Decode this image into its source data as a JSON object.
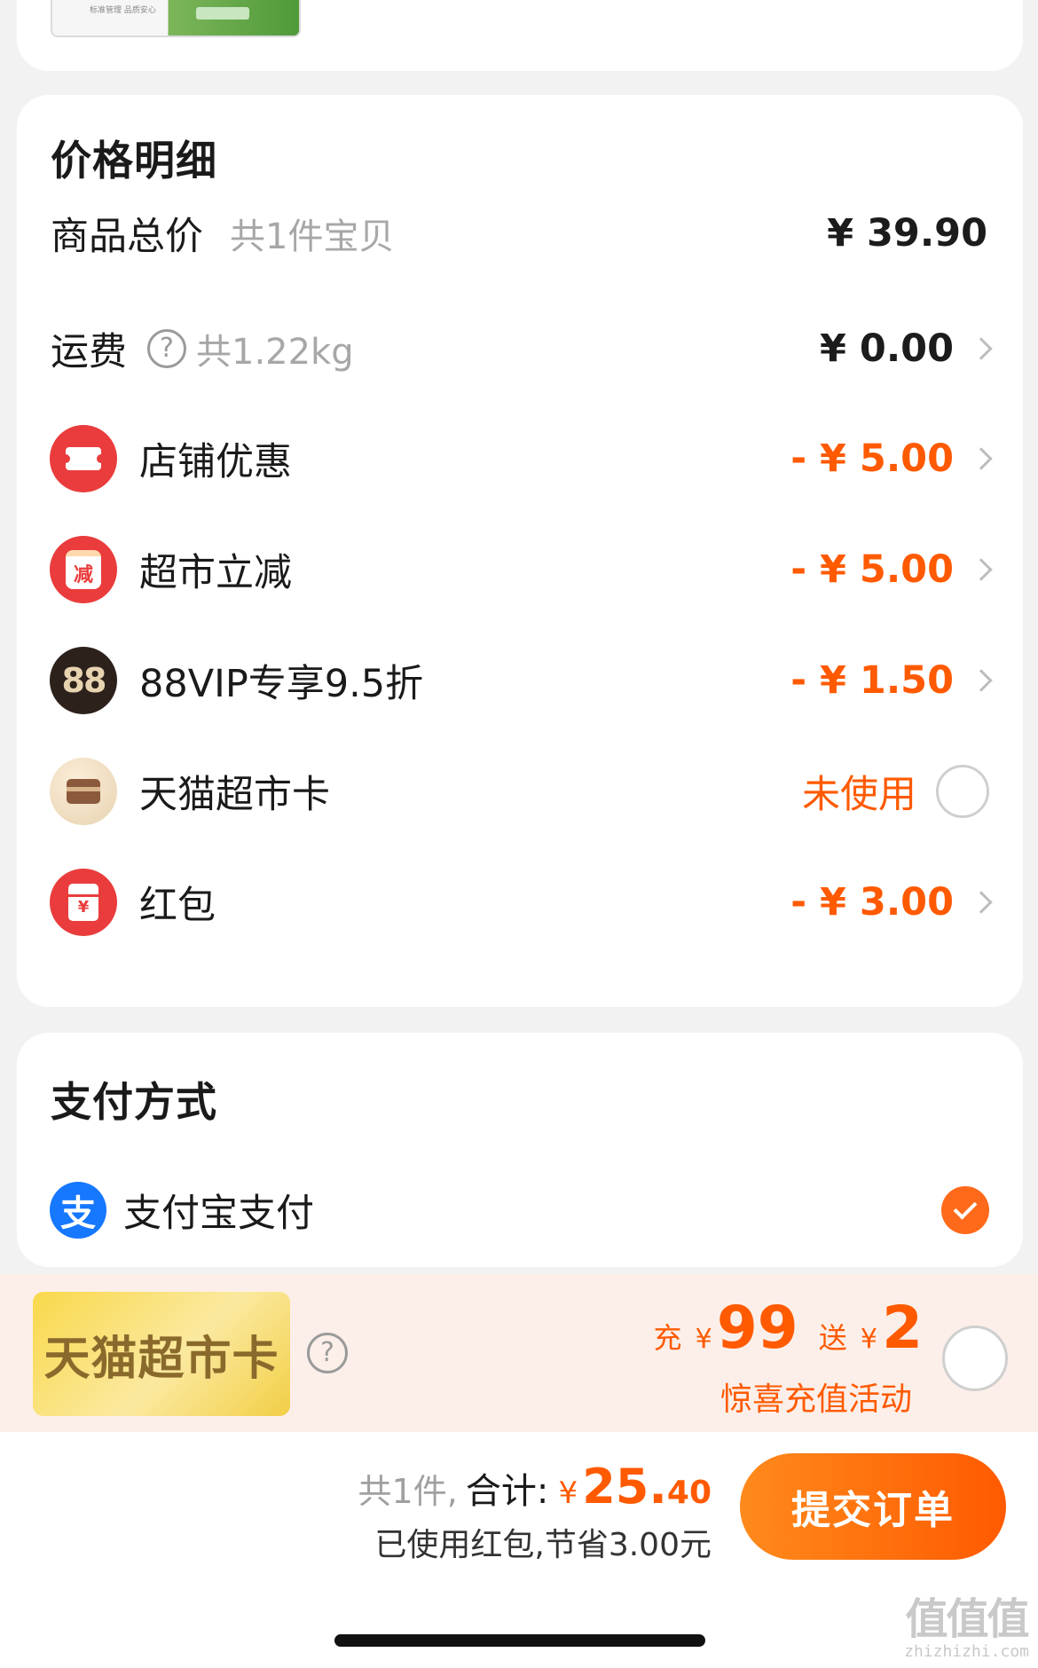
{
  "product": {
    "thumb_caption": "标准管理 品质安心"
  },
  "price_detail": {
    "title": "价格明细",
    "subtotal": {
      "label": "商品总价",
      "note": "共1件宝贝",
      "amount": "¥ 39.90"
    },
    "shipping": {
      "label": "运费",
      "note": "共1.22kg",
      "amount": "¥ 0.00"
    },
    "discounts": [
      {
        "label": "店铺优惠",
        "amount": "- ¥ 5.00",
        "icon": "ticket-icon"
      },
      {
        "label": "超市立减",
        "amount": "- ¥ 5.00",
        "icon": "jian-icon",
        "glyph": "减"
      },
      {
        "label": "88VIP专享9.5折",
        "amount": "- ¥ 1.50",
        "icon": "88vip-icon",
        "glyph": "88"
      },
      {
        "label": "天猫超市卡",
        "status": "未使用",
        "icon": "card-icon"
      },
      {
        "label": "红包",
        "amount": "- ¥ 3.00",
        "icon": "red-envelope-icon",
        "glyph": "¥"
      }
    ]
  },
  "payment": {
    "title": "支付方式",
    "method": {
      "label": "支付宝支付",
      "glyph": "支",
      "selected": true
    }
  },
  "promo": {
    "card_label": "天猫超市卡",
    "charge_prefix": "充",
    "charge_yen": "¥",
    "charge_amount": "99",
    "gift_prefix": "送",
    "gift_yen": "¥",
    "gift_amount": "2",
    "subtitle": "惊喜充值活动",
    "selected": false
  },
  "checkout": {
    "count_text": "共1件,",
    "total_label": "合计:",
    "currency": "¥",
    "total_int": "25.",
    "total_dec": "40",
    "saved_text": "已使用红包,节省3.00元",
    "submit_label": "提交订单"
  },
  "watermark": {
    "logo": "值值值",
    "url": "zhizhizhi.com"
  },
  "colors": {
    "accent": "#ff5a00",
    "card_bg": "#ffffff",
    "page_bg": "#f2f2f2",
    "promo_bg": "#fcefe9",
    "alipay_blue": "#1677ff"
  }
}
